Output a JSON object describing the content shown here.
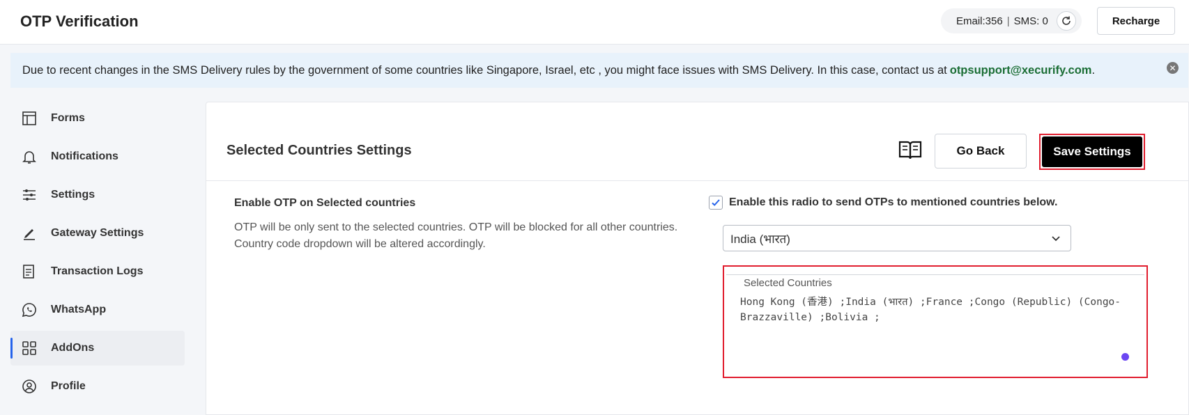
{
  "header": {
    "title": "OTP Verification",
    "quota_email": "Email:356",
    "quota_sep": "|",
    "quota_sms": "SMS: 0",
    "refresh_icon": "refresh-icon",
    "recharge_label": "Recharge"
  },
  "notice": {
    "text": "Due to recent changes in the SMS Delivery rules by the government of some countries like Singapore, Israel, etc , you might face issues with SMS Delivery. In this case, contact us at",
    "email": "otpsupport@xecurify.com",
    "suffix": ".",
    "close_icon": "close-icon"
  },
  "sidebar": {
    "items": [
      {
        "label": "Forms",
        "icon": "forms-icon"
      },
      {
        "label": "Notifications",
        "icon": "bell-icon"
      },
      {
        "label": "Settings",
        "icon": "sliders-icon"
      },
      {
        "label": "Gateway Settings",
        "icon": "pen-icon"
      },
      {
        "label": "Transaction Logs",
        "icon": "log-icon"
      },
      {
        "label": "WhatsApp",
        "icon": "whatsapp-icon"
      },
      {
        "label": "AddOns",
        "icon": "grid-icon",
        "active": true
      },
      {
        "label": "Profile",
        "icon": "user-circle-icon"
      }
    ]
  },
  "main": {
    "title": "Selected Countries Settings",
    "guide_icon": "book-icon",
    "go_back_label": "Go Back",
    "save_label": "Save Settings",
    "option_label": "Enable OTP on Selected countries",
    "option_desc": "OTP will be only sent to the selected countries. OTP will be blocked for all other countries. Country code dropdown will be altered accordingly.",
    "checkbox_checked": true,
    "checkbox_label": "Enable this radio to send OTPs to mentioned countries below.",
    "country_select_value": "India (भारत)",
    "selected_legend": "Selected Countries",
    "selected_value": "Hong Kong (香港) ;India (भारत) ;France ;Congo (Republic) (Congo-Brazzaville) ;Bolivia ;"
  },
  "colors": {
    "accent": "#2563eb",
    "highlight_border": "#e11d2e",
    "link": "#1b6e35",
    "notice_bg": "#e8f2fb"
  }
}
